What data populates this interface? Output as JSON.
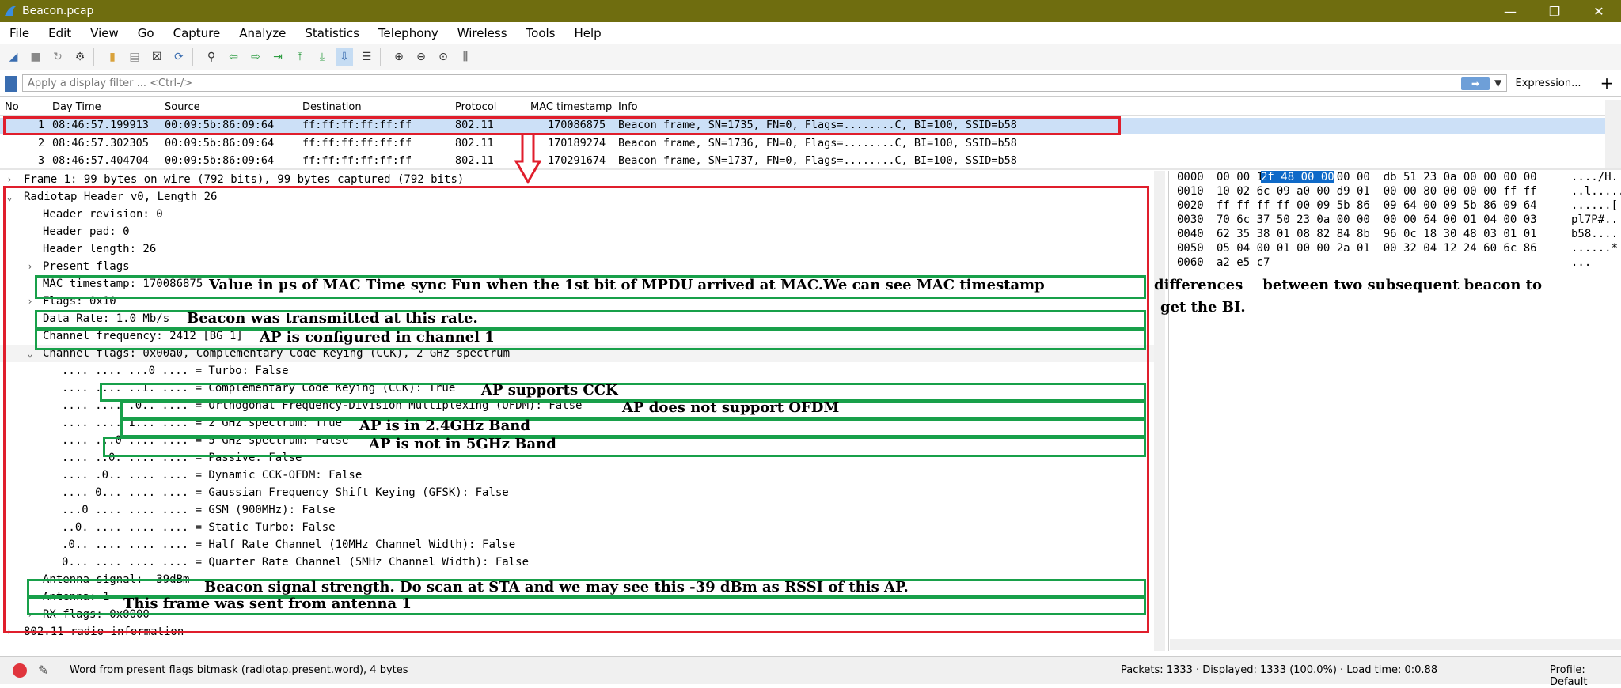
{
  "window": {
    "title": "Beacon.pcap",
    "minimize": "—",
    "maximize": "❐",
    "close": "✕"
  },
  "menu": [
    "File",
    "Edit",
    "View",
    "Go",
    "Capture",
    "Analyze",
    "Statistics",
    "Telephony",
    "Wireless",
    "Tools",
    "Help"
  ],
  "filter": {
    "placeholder": "Apply a display filter ... <Ctrl-/>",
    "expression_label": "Expression...",
    "add_label": "+"
  },
  "packet_list": {
    "columns": [
      "No",
      "Day Time",
      "Source",
      "Destination",
      "Protocol",
      "MAC timestamp",
      "Info"
    ],
    "rows": [
      [
        "1",
        "08:46:57.199913",
        "00:09:5b:86:09:64",
        "ff:ff:ff:ff:ff:ff",
        "802.11",
        "170086875",
        "Beacon frame, SN=1735, FN=0, Flags=........C, BI=100, SSID=b58"
      ],
      [
        "2",
        "08:46:57.302305",
        "00:09:5b:86:09:64",
        "ff:ff:ff:ff:ff:ff",
        "802.11",
        "170189274",
        "Beacon frame, SN=1736, FN=0, Flags=........C, BI=100, SSID=b58"
      ],
      [
        "3",
        "08:46:57.404704",
        "00:09:5b:86:09:64",
        "ff:ff:ff:ff:ff:ff",
        "802.11",
        "170291674",
        "Beacon frame, SN=1737, FN=0, Flags=........C, BI=100, SSID=b58"
      ]
    ]
  },
  "details": [
    {
      "arrow": ">",
      "indent": 0,
      "text": "Frame 1: 99 bytes on wire (792 bits), 99 bytes captured (792 bits)"
    },
    {
      "arrow": "v",
      "indent": 0,
      "text": "Radiotap Header v0, Length 26"
    },
    {
      "arrow": "",
      "indent": 1,
      "text": "Header revision: 0"
    },
    {
      "arrow": "",
      "indent": 1,
      "text": "Header pad: 0"
    },
    {
      "arrow": "",
      "indent": 1,
      "text": "Header length: 26"
    },
    {
      "arrow": ">",
      "indent": 1,
      "text": "Present flags"
    },
    {
      "arrow": "",
      "indent": 1,
      "text": "MAC timestamp: 170086875"
    },
    {
      "arrow": ">",
      "indent": 1,
      "text": "Flags: 0x10"
    },
    {
      "arrow": "",
      "indent": 1,
      "text": "Data Rate: 1.0 Mb/s"
    },
    {
      "arrow": "",
      "indent": 1,
      "text": "Channel frequency: 2412 [BG 1]"
    },
    {
      "arrow": "v",
      "indent": 1,
      "text": "Channel flags: 0x00a0, Complementary Code Keying (CCK), 2 GHz spectrum"
    },
    {
      "arrow": "",
      "indent": 2,
      "text": ".... .... ...0 .... = Turbo: False"
    },
    {
      "arrow": "",
      "indent": 2,
      "text": ".... .... ..1. .... = Complementary Code Keying (CCK): True"
    },
    {
      "arrow": "",
      "indent": 2,
      "text": ".... .... .0.. .... = Orthogonal Frequency-Division Multiplexing (OFDM): False"
    },
    {
      "arrow": "",
      "indent": 2,
      "text": ".... .... 1... .... = 2 GHz spectrum: True"
    },
    {
      "arrow": "",
      "indent": 2,
      "text": ".... ...0 .... .... = 5 GHz spectrum: False"
    },
    {
      "arrow": "",
      "indent": 2,
      "text": ".... ..0. .... .... = Passive: False"
    },
    {
      "arrow": "",
      "indent": 2,
      "text": ".... .0.. .... .... = Dynamic CCK-OFDM: False"
    },
    {
      "arrow": "",
      "indent": 2,
      "text": ".... 0... .... .... = Gaussian Frequency Shift Keying (GFSK): False"
    },
    {
      "arrow": "",
      "indent": 2,
      "text": "...0 .... .... .... = GSM (900MHz): False"
    },
    {
      "arrow": "",
      "indent": 2,
      "text": "..0. .... .... .... = Static Turbo: False"
    },
    {
      "arrow": "",
      "indent": 2,
      "text": ".0.. .... .... .... = Half Rate Channel (10MHz Channel Width): False"
    },
    {
      "arrow": "",
      "indent": 2,
      "text": "0... .... .... .... = Quarter Rate Channel (5MHz Channel Width): False"
    },
    {
      "arrow": "",
      "indent": 1,
      "text": "Antenna signal: -39dBm"
    },
    {
      "arrow": "",
      "indent": 1,
      "text": "Antenna: 1"
    },
    {
      "arrow": ">",
      "indent": 1,
      "text": "RX flags: 0x0000"
    },
    {
      "arrow": ">",
      "indent": 0,
      "text": "802.11 radio information"
    }
  ],
  "hex": [
    {
      "off": "0000",
      "bytes": "00 00 1a 00 2f 48 00 00  db 51 23 0a 00 00 00 00",
      "ascii": "..../H.",
      "hl_bytes": "2f 48 00 00"
    },
    {
      "off": "0010",
      "bytes": "10 02 6c 09 a0 00 d9 01  00 00 80 00 00 00 ff ff",
      "ascii": "..l.....",
      "hl_bytes": ""
    },
    {
      "off": "0020",
      "bytes": "ff ff ff ff 00 09 5b 86  09 64 00 09 5b 86 09 64",
      "ascii": "......[",
      "hl_bytes": ""
    },
    {
      "off": "0030",
      "bytes": "70 6c 37 50 23 0a 00 00  00 00 64 00 01 04 00 03",
      "ascii": "pl7P#..",
      "hl_bytes": ""
    },
    {
      "off": "0040",
      "bytes": "62 35 38 01 08 82 84 8b  96 0c 18 30 48 03 01 01",
      "ascii": "b58....",
      "hl_bytes": ""
    },
    {
      "off": "0050",
      "bytes": "05 04 00 01 00 00 2a 01  00 32 04 12 24 60 6c 86",
      "ascii": "......*",
      "hl_bytes": ""
    },
    {
      "off": "0060",
      "bytes": "a2 e5 c7",
      "ascii": "...",
      "hl_bytes": ""
    }
  ],
  "annotations": {
    "mac_ts": "Value in µs of MAC Time sync Fun when the 1st bit of MPDU arrived at MAC.We can see MAC timestamp",
    "mac_ts_cont1": "differences    between two subsequent beacon to",
    "mac_ts_cont2": "get the BI.",
    "rate": "Beacon was transmitted at this rate.",
    "channel": "AP is configured in channel 1",
    "cck": "AP supports CCK",
    "ofdm": "AP does not support OFDM",
    "ghz2": "AP is in 2.4GHz Band",
    "ghz5": "AP is not in 5GHz Band",
    "signal": "Beacon signal strength. Do scan at STA and we may see this -39 dBm as RSSI of this AP.",
    "antenna": "This frame was sent from antenna 1"
  },
  "status": {
    "field_info": "Word from present flags bitmask (radiotap.present.word), 4 bytes",
    "packets": "Packets: 1333 · Displayed: 1333 (100.0%) · Load time: 0:0.88",
    "profile": "Profile: Default"
  },
  "colors": {
    "title_bg": "#6f6d0f",
    "red_box": "#e01e2c",
    "green_box": "#18a04a",
    "selection": "#cce0f7",
    "hex_highlight": "#0e69c8"
  }
}
